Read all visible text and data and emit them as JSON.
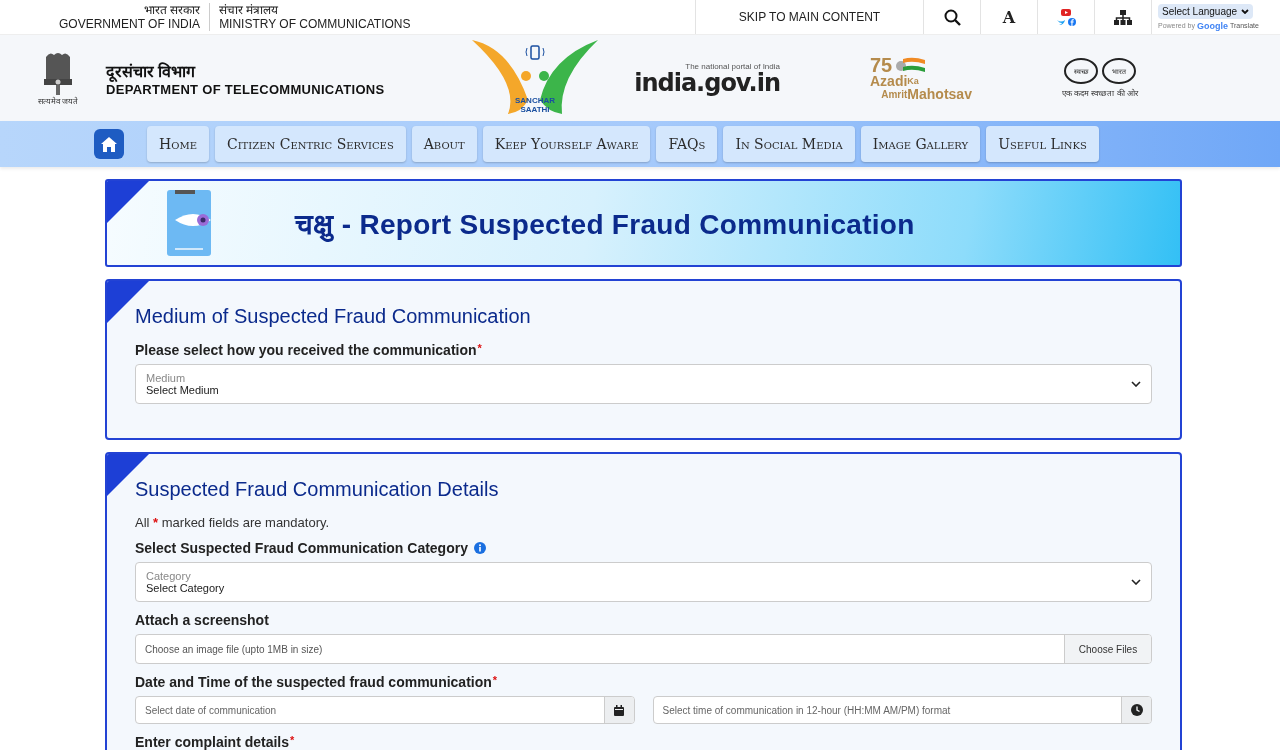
{
  "topbar": {
    "government": {
      "hindi": "भारत सरकार",
      "english": "GOVERNMENT OF INDIA"
    },
    "ministry": {
      "hindi": "संचार मंत्रालय",
      "english": "MINISTRY OF COMMUNICATIONS"
    },
    "skip_link": "SKIP TO MAIN CONTENT",
    "font_size_label": "A",
    "language_select": "Select Language",
    "powered_by": "Powered by",
    "google": "Google",
    "translate": "Translate"
  },
  "header": {
    "emblem_motto": "सत्यमेव जयते",
    "department_hindi": "दूरसंचार विभाग",
    "department": "DEPARTMENT OF TELECOMMUNICATIONS",
    "sanchar_saathi": "SANCHAR SAATHI",
    "india_portal": {
      "tagline": "The national portal of India",
      "name": "india.gov.in"
    },
    "azadi": {
      "number": "75",
      "line1": "Azadi",
      "ka": "Ka",
      "line2": "Amrit",
      "mahotsav": "Mahotsav"
    },
    "swachh": {
      "left": "स्वच्छ",
      "right": "भारत",
      "slogan": "एक कदम स्वच्छता की ओर"
    }
  },
  "nav": [
    "Home",
    "Citizen Centric Services",
    "About",
    "Keep Yourself Aware",
    "FAQs",
    "In Social Media",
    "Image Gallery",
    "Useful Links"
  ],
  "banner": {
    "title": "चक्षु - Report Suspected Fraud Communication"
  },
  "sections": [
    {
      "title": "Medium of Suspected Fraud Communication",
      "fields": [
        {
          "kind": "select",
          "label": "Please select how you received the communication",
          "required": true,
          "required_mark": "*",
          "caption": "Medium",
          "value": "Select Medium"
        }
      ]
    },
    {
      "title": "Suspected Fraud Communication Details",
      "fields": [
        {
          "kind": "note",
          "before": "All",
          "mark": "*",
          "after": "marked fields are mandatory."
        },
        {
          "kind": "select",
          "label": "Select Suspected Fraud Communication Category",
          "required": false,
          "info": true,
          "caption": "Category",
          "value": "Select Category"
        },
        {
          "kind": "file",
          "label": "Attach a screenshot",
          "required": false,
          "placeholder": "Choose an image file (upto 1MB in size)",
          "button": "Choose Files"
        },
        {
          "kind": "datetime",
          "label": "Date and Time of the suspected fraud communication",
          "required": true,
          "required_mark": "*",
          "date_placeholder": "Select date of communication",
          "time_placeholder": "Select time of communication in 12-hour (HH:MM AM/PM) format"
        },
        {
          "kind": "label",
          "label": "Enter complaint details",
          "required": true,
          "required_mark": "*"
        }
      ]
    }
  ]
}
